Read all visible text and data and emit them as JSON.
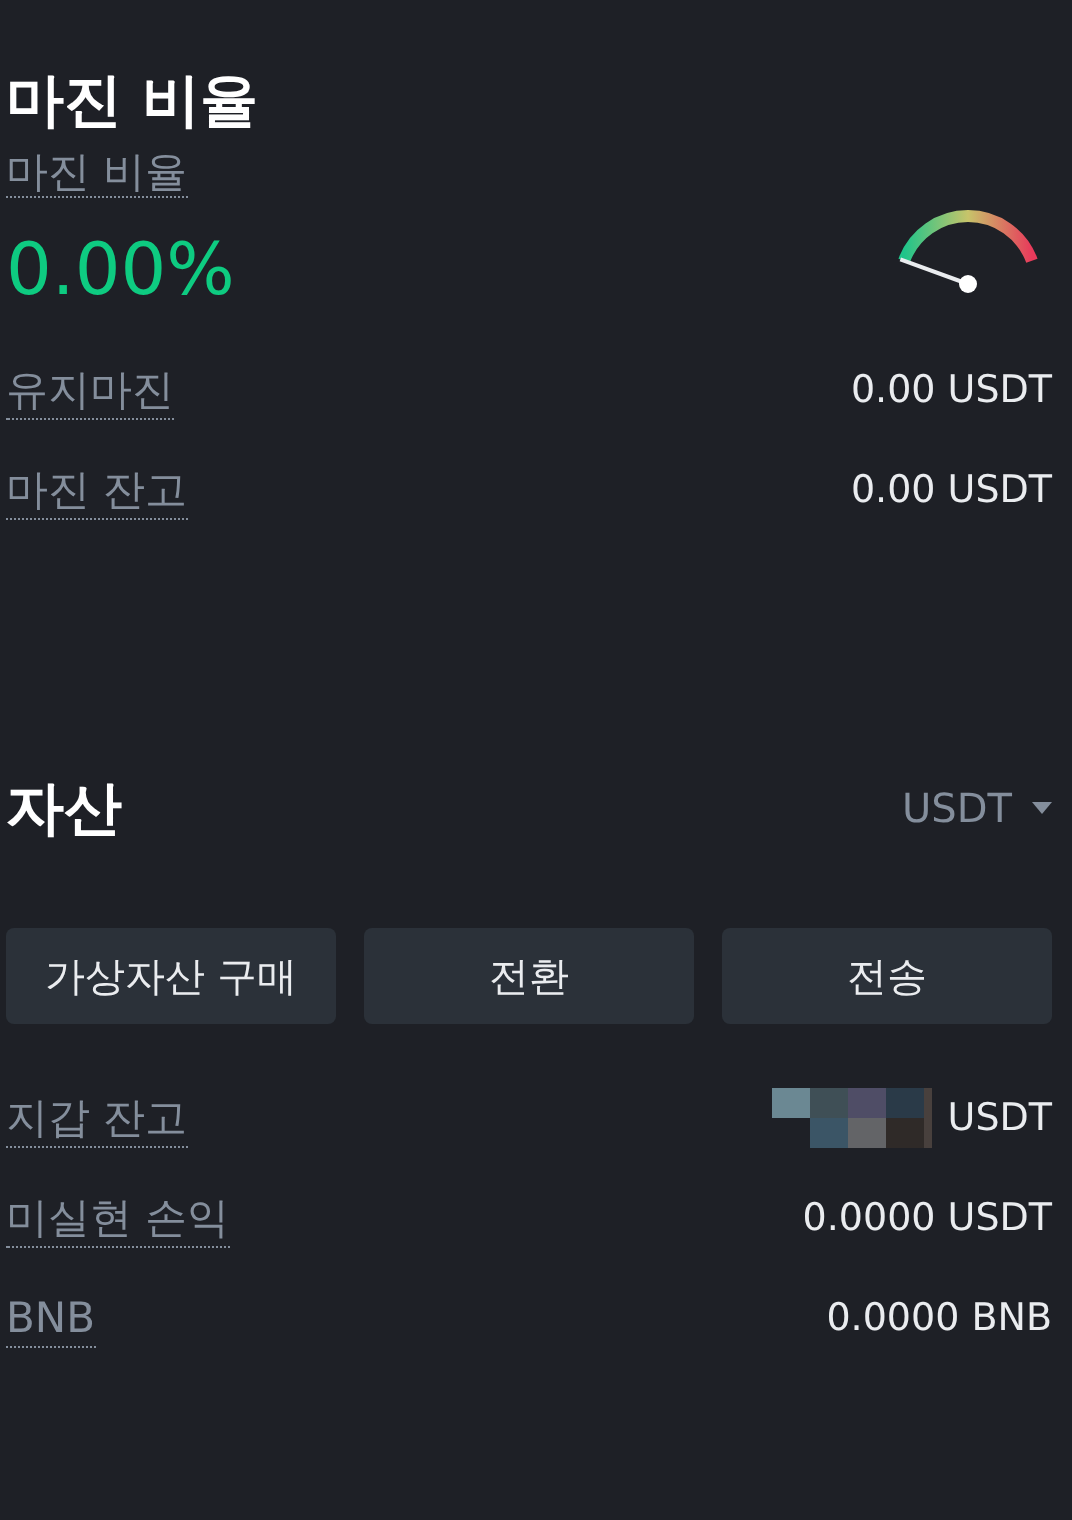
{
  "margin": {
    "title": "마진 비율",
    "ratio_label": "마진 비율",
    "ratio_value": "0.00%",
    "rows": [
      {
        "label": "유지마진",
        "value": "0.00 USDT"
      },
      {
        "label": "마진 잔고",
        "value": "0.00 USDT"
      }
    ]
  },
  "assets": {
    "title": "자산",
    "currency": "USDT",
    "buttons": [
      "가상자산 구매",
      "전환",
      "전송"
    ],
    "rows": [
      {
        "label": "지갑 잔고",
        "value": "USDT",
        "redacted": true
      },
      {
        "label": "미실현 손익",
        "value": "0.0000 USDT",
        "redacted": false
      },
      {
        "label": "BNB",
        "value": "0.0000 BNB",
        "redacted": false
      }
    ]
  }
}
